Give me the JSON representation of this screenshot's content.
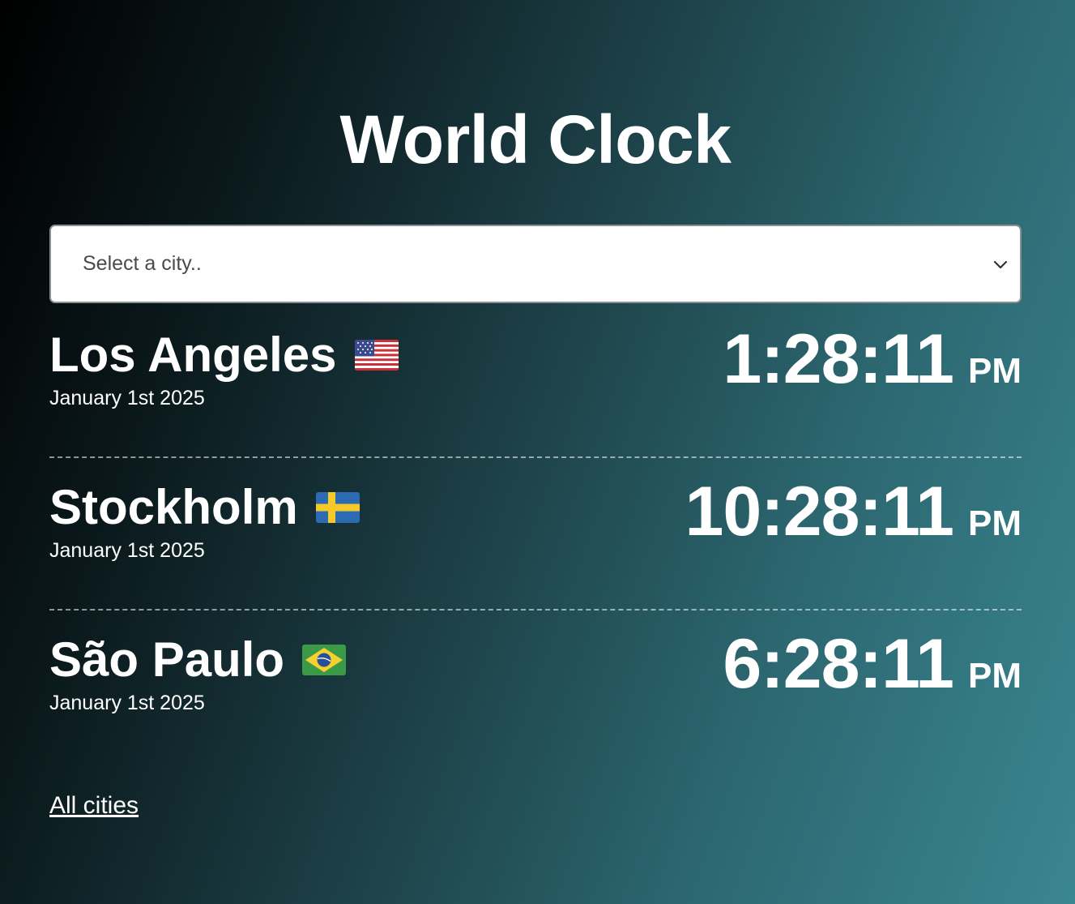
{
  "page": {
    "title": "World Clock"
  },
  "city_select": {
    "placeholder": "Select a city..",
    "icon": "chevron-down-icon"
  },
  "cities": [
    {
      "name": "Los Angeles",
      "flag_icon": "flag-united-states-icon",
      "date": "January 1st 2025",
      "time": "1:28:11",
      "ampm": "PM"
    },
    {
      "name": "Stockholm",
      "flag_icon": "flag-sweden-icon",
      "date": "January 1st 2025",
      "time": "10:28:11",
      "ampm": "PM"
    },
    {
      "name": "São Paulo",
      "flag_icon": "flag-brazil-icon",
      "date": "January 1st 2025",
      "time": "6:28:11",
      "ampm": "PM"
    }
  ],
  "footer": {
    "all_cities_link": "All cities"
  },
  "colors": {
    "background_start": "#000000",
    "background_end": "#3a8691",
    "text": "#ffffff",
    "select_background": "#ffffff",
    "select_text": "#4a4a4a"
  }
}
